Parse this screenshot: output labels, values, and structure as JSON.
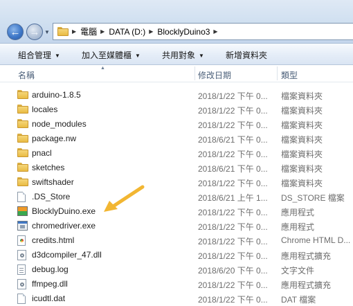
{
  "address": {
    "crumbs": [
      "電腦",
      "DATA (D:)",
      "BlocklyDuino3"
    ]
  },
  "toolbar": {
    "organize": "組合管理",
    "include_library": "加入至媒體櫃",
    "share": "共用對象",
    "new_folder": "新增資料夾"
  },
  "columns": {
    "name": "名稱",
    "modified": "修改日期",
    "type": "類型"
  },
  "files": [
    {
      "name": "arduino-1.8.5",
      "date": "2018/1/22 下午 0...",
      "type": "檔案資料夾",
      "icon": "folder-icon"
    },
    {
      "name": "locales",
      "date": "2018/1/22 下午 0...",
      "type": "檔案資料夾",
      "icon": "folder-icon"
    },
    {
      "name": "node_modules",
      "date": "2018/1/22 下午 0...",
      "type": "檔案資料夾",
      "icon": "folder-icon"
    },
    {
      "name": "package.nw",
      "date": "2018/6/21 下午 0...",
      "type": "檔案資料夾",
      "icon": "folder-icon"
    },
    {
      "name": "pnacl",
      "date": "2018/1/22 下午 0...",
      "type": "檔案資料夾",
      "icon": "folder-icon"
    },
    {
      "name": "sketches",
      "date": "2018/6/21 下午 0...",
      "type": "檔案資料夾",
      "icon": "folder-icon"
    },
    {
      "name": "swiftshader",
      "date": "2018/1/22 下午 0...",
      "type": "檔案資料夾",
      "icon": "folder-icon"
    },
    {
      "name": ".DS_Store",
      "date": "2018/6/21 上午 1...",
      "type": "DS_STORE 檔案",
      "icon": "file-icon"
    },
    {
      "name": "BlocklyDuino.exe",
      "date": "2018/1/22 下午 0...",
      "type": "應用程式",
      "icon": "blocklyduino-app-icon"
    },
    {
      "name": "chromedriver.exe",
      "date": "2018/1/22 下午 0...",
      "type": "應用程式",
      "icon": "application-icon"
    },
    {
      "name": "credits.html",
      "date": "2018/1/22 下午 0...",
      "type": "Chrome HTML D...",
      "icon": "chrome-html-icon"
    },
    {
      "name": "d3dcompiler_47.dll",
      "date": "2018/1/22 下午 0...",
      "type": "應用程式擴充",
      "icon": "dll-icon"
    },
    {
      "name": "debug.log",
      "date": "2018/6/20 下午 0...",
      "type": "文字文件",
      "icon": "text-file-icon"
    },
    {
      "name": "ffmpeg.dll",
      "date": "2018/1/22 下午 0...",
      "type": "應用程式擴充",
      "icon": "dll-icon"
    },
    {
      "name": "icudtl.dat",
      "date": "2018/1/22 下午 0...",
      "type": "DAT 檔案",
      "icon": "file-icon"
    }
  ],
  "colors": {
    "annotation_arrow": "#f2b632",
    "title_bar": "#cfdff0"
  }
}
